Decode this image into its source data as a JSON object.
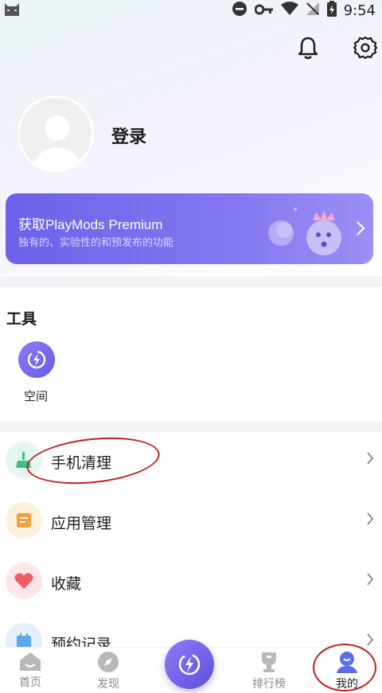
{
  "status_bar": {
    "time": "9:54"
  },
  "profile": {
    "login_label": "登录"
  },
  "premium": {
    "title": "获取PlayMods Premium",
    "subtitle": "独有的、实验性的和预发布的功能"
  },
  "tools": {
    "section_title": "工具",
    "items": [
      {
        "label": "空间",
        "icon": "space-icon"
      }
    ]
  },
  "menu": [
    {
      "label": "手机清理",
      "icon": "broom-icon",
      "color": "#3bbf8a"
    },
    {
      "label": "应用管理",
      "icon": "app-manage-icon",
      "color": "#f3a23a"
    },
    {
      "label": "收藏",
      "icon": "heart-icon",
      "color": "#f25c67"
    },
    {
      "label": "预约记录",
      "icon": "calendar-icon",
      "color": "#5aa8e8"
    }
  ],
  "tabbar": {
    "items": [
      {
        "label": "首页",
        "icon": "home-icon"
      },
      {
        "label": "发现",
        "icon": "compass-icon"
      },
      {
        "label": "排行榜",
        "icon": "trophy-icon"
      },
      {
        "label": "我的",
        "icon": "profile-icon",
        "active": true
      }
    ]
  },
  "colors": {
    "accent": "#6c62e9",
    "annotation": "#c41f1f"
  }
}
